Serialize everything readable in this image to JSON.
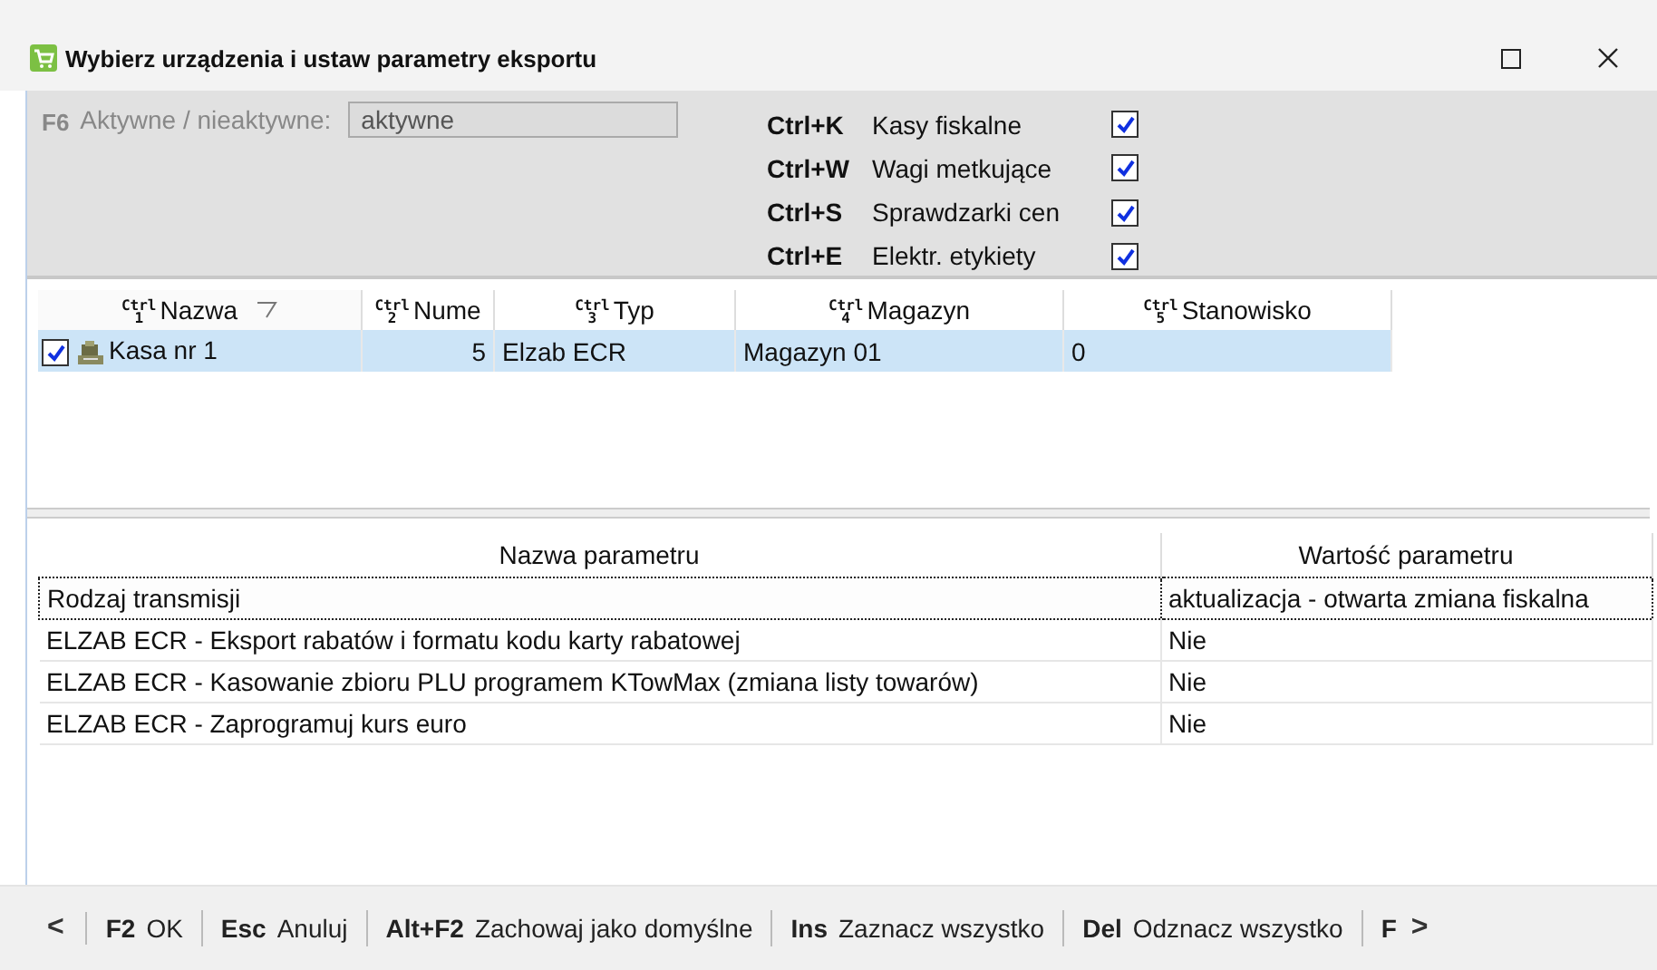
{
  "window": {
    "title": "Wybierz urządzenia i ustaw parametry eksportu"
  },
  "filter": {
    "key": "F6",
    "label": "Aktywne / nieaktywne:",
    "value": "aktywne"
  },
  "device_types": [
    {
      "key": "Ctrl+K",
      "label": "Kasy fiskalne",
      "checked": true
    },
    {
      "key": "Ctrl+W",
      "label": "Wagi metkujące",
      "checked": true
    },
    {
      "key": "Ctrl+S",
      "label": "Sprawdzarki cen",
      "checked": true
    },
    {
      "key": "Ctrl+E",
      "label": "Elektr. etykiety",
      "checked": true
    }
  ],
  "devices": {
    "columns": [
      {
        "hotkey": "Ctrl",
        "index": "1",
        "label": "Nazwa",
        "sorted": true
      },
      {
        "hotkey": "Ctrl",
        "index": "2",
        "label": "Nume",
        "sorted": false
      },
      {
        "hotkey": "Ctrl",
        "index": "3",
        "label": "Typ",
        "sorted": false
      },
      {
        "hotkey": "Ctrl",
        "index": "4",
        "label": "Magazyn",
        "sorted": false
      },
      {
        "hotkey": "Ctrl",
        "index": "5",
        "label": "Stanowisko",
        "sorted": false
      }
    ],
    "rows": [
      {
        "checked": true,
        "selected": true,
        "cells": [
          "Kasa nr 1",
          "5",
          "Elzab ECR",
          "Magazyn 01",
          "0"
        ]
      }
    ]
  },
  "parameters": {
    "columns": [
      "Nazwa parametru",
      "Wartość parametru"
    ],
    "rows": [
      {
        "name": "Rodzaj transmisji",
        "value": "aktualizacja - otwarta zmiana fiskalna",
        "focused": true
      },
      {
        "name": "ELZAB ECR - Eksport rabatów i formatu kodu karty rabatowej",
        "value": "Nie",
        "focused": false
      },
      {
        "name": "ELZAB ECR - Kasowanie zbioru PLU programem KTowMax (zmiana listy towarów)",
        "value": "Nie",
        "focused": false
      },
      {
        "name": "ELZAB ECR - Zaprogramuj kurs euro",
        "value": "Nie",
        "focused": false
      }
    ]
  },
  "shortcut_bar": {
    "prev": "<",
    "next": ">",
    "items": [
      {
        "key": "F2",
        "label": "OK"
      },
      {
        "key": "Esc",
        "label": "Anuluj"
      },
      {
        "key": "Alt+F2",
        "label": "Zachowaj jako domyślne"
      },
      {
        "key": "Ins",
        "label": "Zaznacz wszystko"
      },
      {
        "key": "Del",
        "label": "Odznacz wszystko"
      },
      {
        "key": "F"
      }
    ]
  }
}
